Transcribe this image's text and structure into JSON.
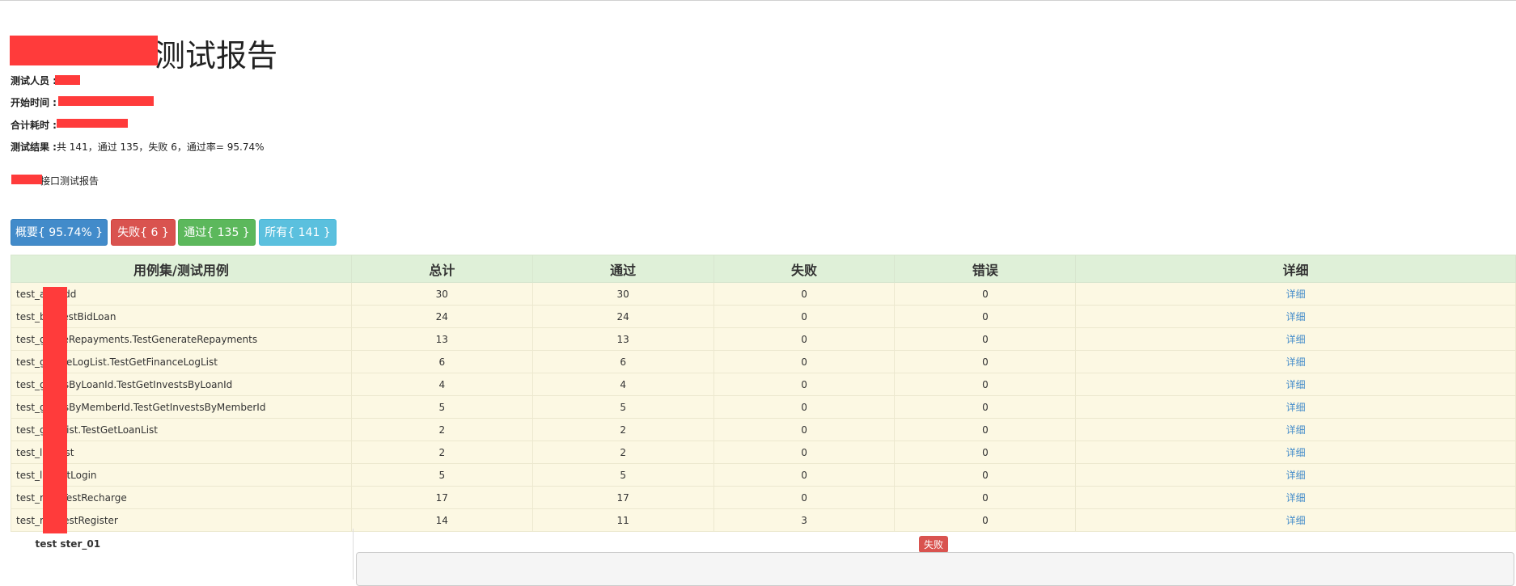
{
  "report": {
    "title_suffix": "测试报告",
    "tester_label": "测试人员 :",
    "start_label": "开始时间 :",
    "duration_label": "合计耗时 :",
    "result_label": "测试结果 :",
    "result_value": "共 141，通过 135，失败 6，通过率= 95.74%",
    "description_suffix": "接口测试报告"
  },
  "buttons": {
    "summary": "概要{ 95.74% }",
    "failed": "失败{ 6 }",
    "passed": "通过{ 135 }",
    "all": "所有{ 141 }"
  },
  "table": {
    "headers": [
      "用例集/测试用例",
      "总计",
      "通过",
      "失败",
      "错误",
      "详细"
    ],
    "rows": [
      {
        "name": "test_a      stAdd",
        "total": "30",
        "pass": "30",
        "fail": "0",
        "error": "0",
        "detail": "详细"
      },
      {
        "name": "test_b      n.TestBidLoan",
        "total": "24",
        "pass": "24",
        "fail": "0",
        "error": "0",
        "detail": "详细"
      },
      {
        "name": "test_g      rateRepayments.TestGenerateRepayments",
        "total": "13",
        "pass": "13",
        "fail": "0",
        "error": "0",
        "detail": "详细"
      },
      {
        "name": "test_g      anceLogList.TestGetFinanceLogList",
        "total": "6",
        "pass": "6",
        "fail": "0",
        "error": "0",
        "detail": "详细"
      },
      {
        "name": "test_g      estsByLoanId.TestGetInvestsByLoanId",
        "total": "4",
        "pass": "4",
        "fail": "0",
        "error": "0",
        "detail": "详细"
      },
      {
        "name": "test_g      estsByMemberId.TestGetInvestsByMemberId",
        "total": "5",
        "pass": "5",
        "fail": "0",
        "error": "0",
        "detail": "详细"
      },
      {
        "name": "test_g      anList.TestGetLoanList",
        "total": "2",
        "pass": "2",
        "fail": "0",
        "error": "0",
        "detail": "详细"
      },
      {
        "name": "test_li      stList",
        "total": "2",
        "pass": "2",
        "fail": "0",
        "error": "0",
        "detail": "详细"
      },
      {
        "name": "test_lo      TestLogin",
        "total": "5",
        "pass": "5",
        "fail": "0",
        "error": "0",
        "detail": "详细"
      },
      {
        "name": "test_r      ge.TestRecharge",
        "total": "17",
        "pass": "17",
        "fail": "0",
        "error": "0",
        "detail": "详细"
      },
      {
        "name": "test_r      er.TestRegister",
        "total": "14",
        "pass": "11",
        "fail": "3",
        "error": "0",
        "detail": "详细"
      }
    ],
    "failed_case": {
      "name": "test       ster_01",
      "status": "失败"
    }
  },
  "colors": {
    "primary": "#428bca",
    "danger": "#d9534f",
    "success": "#5cb85c",
    "info": "#5bc0de",
    "header_bg": "#dff0d8",
    "row_bg": "#fcf8e3",
    "redaction": "#ff3b3b"
  }
}
